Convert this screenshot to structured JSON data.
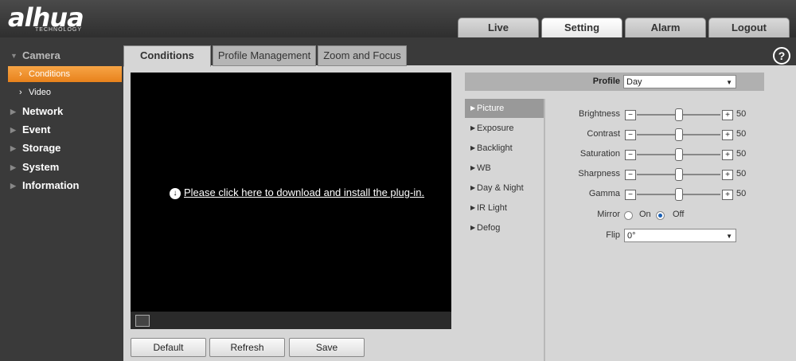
{
  "brand": {
    "logo": "alhua",
    "sub": "TECHNOLOGY"
  },
  "topnav": [
    {
      "label": "Live"
    },
    {
      "label": "Setting"
    },
    {
      "label": "Alarm"
    },
    {
      "label": "Logout"
    }
  ],
  "sidebar": {
    "camera": "Camera",
    "conditions": "Conditions",
    "video": "Video",
    "network": "Network",
    "event": "Event",
    "storage": "Storage",
    "system": "System",
    "information": "Information"
  },
  "tabs": [
    {
      "label": "Conditions"
    },
    {
      "label": "Profile Management"
    },
    {
      "label": "Zoom and Focus"
    }
  ],
  "help": "?",
  "video": {
    "plugin_text": "Please click here to download and install the plug-in."
  },
  "buttons": {
    "default": "Default",
    "refresh": "Refresh",
    "save": "Save"
  },
  "profile": {
    "label": "Profile",
    "value": "Day"
  },
  "menu": [
    {
      "label": "Picture"
    },
    {
      "label": "Exposure"
    },
    {
      "label": "Backlight"
    },
    {
      "label": "WB"
    },
    {
      "label": "Day & Night"
    },
    {
      "label": "IR Light"
    },
    {
      "label": "Defog"
    }
  ],
  "settings": {
    "brightness": {
      "label": "Brightness",
      "value": "50"
    },
    "contrast": {
      "label": "Contrast",
      "value": "50"
    },
    "saturation": {
      "label": "Saturation",
      "value": "50"
    },
    "sharpness": {
      "label": "Sharpness",
      "value": "50"
    },
    "gamma": {
      "label": "Gamma",
      "value": "50"
    },
    "mirror": {
      "label": "Mirror",
      "on": "On",
      "off": "Off",
      "selected": "Off"
    },
    "flip": {
      "label": "Flip",
      "value": "0°"
    }
  },
  "colors": {
    "accent": "#e8821c",
    "bg": "#3a3a3a",
    "panel": "#d6d6d6"
  }
}
